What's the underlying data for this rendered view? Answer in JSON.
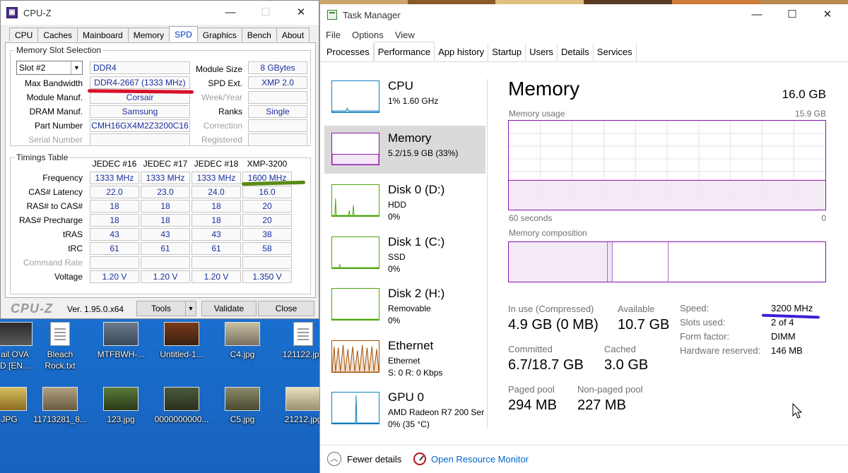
{
  "cpuz": {
    "title": "CPU-Z",
    "tabs": [
      "CPU",
      "Caches",
      "Mainboard",
      "Memory",
      "SPD",
      "Graphics",
      "Bench",
      "About"
    ],
    "active_tab": "SPD",
    "slot_group": "Memory Slot Selection",
    "slot_select": "Slot #2",
    "type_value": "DDR4",
    "fields_left": [
      {
        "label": "Max Bandwidth",
        "value": "DDR4-2667 (1333 MHz)"
      },
      {
        "label": "Module Manuf.",
        "value": "Corsair"
      },
      {
        "label": "DRAM Manuf.",
        "value": "Samsung"
      },
      {
        "label": "Part Number",
        "value": "CMH16GX4M2Z3200C16"
      },
      {
        "label": "Serial Number",
        "value": ""
      }
    ],
    "fields_right": [
      {
        "label": "Module Size",
        "value": "8 GBytes"
      },
      {
        "label": "SPD Ext.",
        "value": "XMP 2.0"
      },
      {
        "label": "Week/Year",
        "value": ""
      },
      {
        "label": "Ranks",
        "value": "Single"
      },
      {
        "label": "Correction",
        "value": ""
      },
      {
        "label": "Registered",
        "value": ""
      }
    ],
    "timings_group": "Timings Table",
    "timing_columns": [
      "JEDEC #16",
      "JEDEC #17",
      "JEDEC #18",
      "XMP-3200"
    ],
    "timing_rows": [
      {
        "label": "Frequency",
        "values": [
          "1333 MHz",
          "1333 MHz",
          "1333 MHz",
          "1600 MHz"
        ]
      },
      {
        "label": "CAS# Latency",
        "values": [
          "22.0",
          "23.0",
          "24.0",
          "16.0"
        ]
      },
      {
        "label": "RAS# to CAS#",
        "values": [
          "18",
          "18",
          "18",
          "20"
        ]
      },
      {
        "label": "RAS# Precharge",
        "values": [
          "18",
          "18",
          "18",
          "20"
        ]
      },
      {
        "label": "tRAS",
        "values": [
          "43",
          "43",
          "43",
          "38"
        ]
      },
      {
        "label": "tRC",
        "values": [
          "61",
          "61",
          "61",
          "58"
        ]
      },
      {
        "label": "Command Rate",
        "values": [
          "",
          "",
          "",
          ""
        ]
      },
      {
        "label": "Voltage",
        "values": [
          "1.20 V",
          "1.20 V",
          "1.20 V",
          "1.350 V"
        ]
      }
    ],
    "brand": "CPU-Z",
    "version": "Ver. 1.95.0.x64",
    "tools_btn": "Tools",
    "validate_btn": "Validate",
    "close_btn": "Close"
  },
  "desktop": {
    "icons": [
      {
        "label": "ail OVA\nD [EN..."
      },
      {
        "label": "Bleach\nRock.txt"
      },
      {
        "label": "MTFBWH-..."
      },
      {
        "label": "Untitled-1..."
      },
      {
        "label": "C4.jpg"
      },
      {
        "label": "121122.jpg"
      },
      {
        "label": "JPG"
      },
      {
        "label": "11713281_8..."
      },
      {
        "label": "123.jpg"
      },
      {
        "label": "0000000000..."
      },
      {
        "label": "C5.jpg"
      },
      {
        "label": "21212.jpg"
      }
    ]
  },
  "taskmanager": {
    "title": "Task Manager",
    "menu": [
      "File",
      "Options",
      "View"
    ],
    "tabs": [
      "Processes",
      "Performance",
      "App history",
      "Startup",
      "Users",
      "Details",
      "Services"
    ],
    "active_tab": "Performance",
    "sidebar": [
      {
        "name": "CPU",
        "sub1": "1% 1.60 GHz",
        "sub2": "",
        "color": "#117dbb"
      },
      {
        "name": "Memory",
        "sub1": "5.2/15.9 GB (33%)",
        "sub2": "",
        "color": "#8b12ae"
      },
      {
        "name": "Disk 0 (D:)",
        "sub1": "HDD",
        "sub2": "0%",
        "color": "#4da60c"
      },
      {
        "name": "Disk 1 (C:)",
        "sub1": "SSD",
        "sub2": "0%",
        "color": "#4da60c"
      },
      {
        "name": "Disk 2 (H:)",
        "sub1": "Removable",
        "sub2": "0%",
        "color": "#4da60c"
      },
      {
        "name": "Ethernet",
        "sub1": "Ethernet",
        "sub2": "S: 0 R: 0 Kbps",
        "color": "#a74f01"
      },
      {
        "name": "GPU 0",
        "sub1": "AMD Radeon R7 200 Ser",
        "sub2": "0% (35 °C)",
        "color": "#117dbb"
      }
    ],
    "main": {
      "heading": "Memory",
      "total": "16.0 GB",
      "usage_label": "Memory usage",
      "usage_max": "15.9 GB",
      "usage_fraction": 0.33,
      "time_left": "60 seconds",
      "time_right": "0",
      "composition_label": "Memory composition",
      "stats": [
        {
          "label": "In use (Compressed)",
          "value": "4.9 GB (0 MB)"
        },
        {
          "label": "Available",
          "value": "10.7 GB"
        },
        {
          "label": "Committed",
          "value": "6.7/18.7 GB"
        },
        {
          "label": "Cached",
          "value": "3.0 GB"
        },
        {
          "label": "Paged pool",
          "value": "294 MB"
        },
        {
          "label": "Non-paged pool",
          "value": "227 MB"
        }
      ],
      "specs": [
        {
          "label": "Speed:",
          "value": "3200 MHz"
        },
        {
          "label": "Slots used:",
          "value": "2 of 4"
        },
        {
          "label": "Form factor:",
          "value": "DIMM"
        },
        {
          "label": "Hardware reserved:",
          "value": "146 MB"
        }
      ]
    },
    "footer": {
      "fewer_details": "Fewer details",
      "resource_monitor": "Open Resource Monitor"
    }
  },
  "colors": {
    "memory_accent": "#8b12ae",
    "red_marker": "#d8102a",
    "green_marker": "#5a8a12",
    "blue_marker": "#3a1fd6"
  }
}
